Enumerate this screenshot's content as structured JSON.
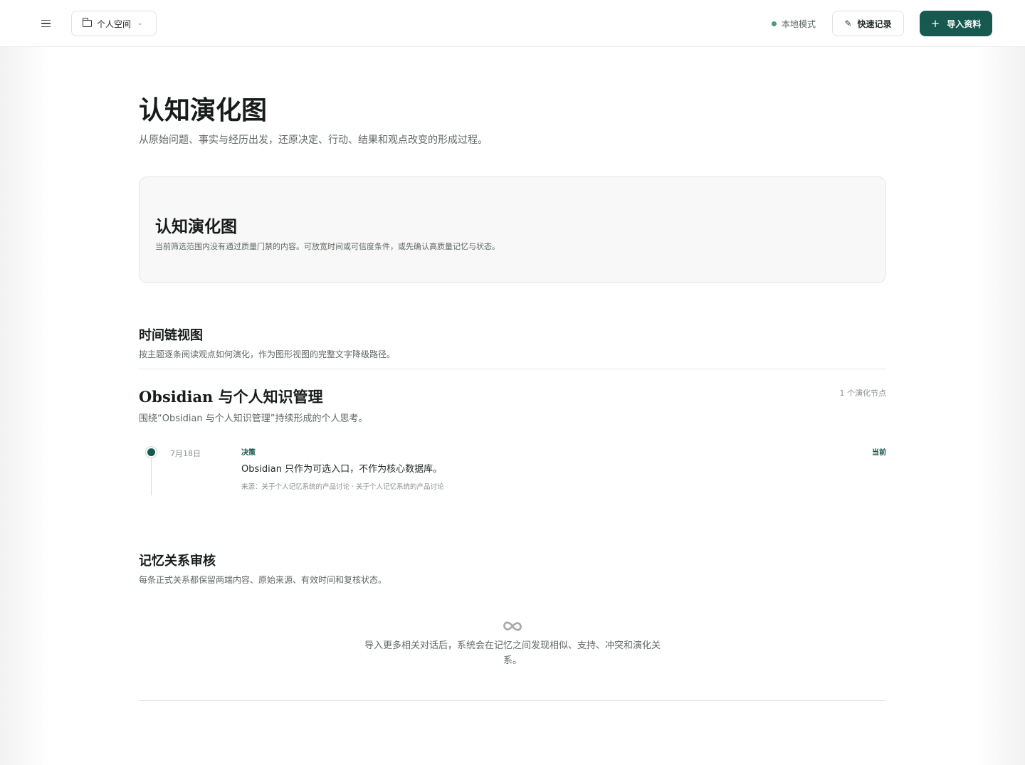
{
  "header": {
    "workspace_label": "个人空间",
    "mode_label": "本地模式",
    "quick_record_label": "快速记录",
    "import_label": "导入资料",
    "icons": {
      "menu": "menu-icon",
      "workspace": "folder-icon",
      "dropdown": "chevron-down-icon",
      "quick_record": "pencil-icon",
      "import": "plus-icon"
    }
  },
  "page": {
    "title": "认知演化图",
    "subtitle": "从原始问题、事实与经历出发，还原决定、行动、结果和观点改变的形成过程。"
  },
  "graph_card": {
    "title": "认知演化图",
    "description": "当前筛选范围内没有通过质量门禁的内容。可放宽时间或可信度条件，或先确认高质量记忆与状态。"
  },
  "timeline_section": {
    "title": "时间链视图",
    "description": "按主题逐条阅读观点如何演化，作为图形视图的完整文字降级路径。",
    "topic": {
      "title": "Obsidian 与个人知识管理",
      "count_label": "1 个演化节点",
      "description": "围绕“Obsidian 与个人知识管理”持续形成的个人思考。",
      "entries": [
        {
          "date": "7月18日",
          "kind": "决策",
          "status": "当前",
          "text": "Obsidian 只作为可选入口，不作为核心数据库。",
          "source": "来源：关于个人记忆系统的产品讨论 · 关于个人记忆系统的产品讨论"
        }
      ]
    }
  },
  "relation_section": {
    "title": "记忆关系审核",
    "description": "每条正式关系都保留两端内容、原始来源、有效时间和复核状态。",
    "empty_text": "导入更多相关对话后，系统会在记忆之间发现相似、支持、冲突和演化关系。",
    "empty_icon": "link-icon"
  },
  "colors": {
    "accent": "#17584f",
    "status_dot": "#4d9a76"
  }
}
